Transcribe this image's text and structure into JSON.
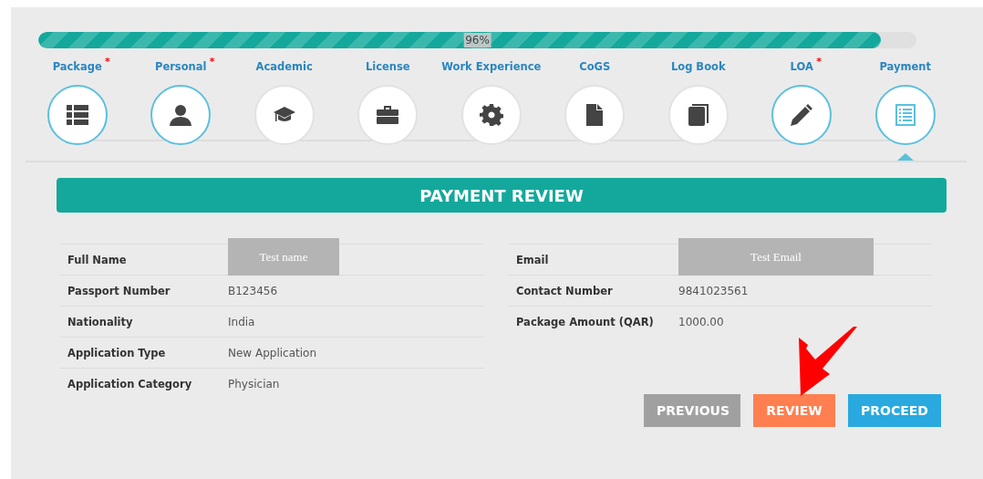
{
  "progress": {
    "level": 0.96,
    "reading": "96%"
  },
  "steps": [
    {
      "label": "Package",
      "marker": "*",
      "done": true,
      "selected": false,
      "kind": "list"
    },
    {
      "label": "Personal",
      "marker": "*",
      "done": true,
      "selected": false,
      "kind": "person"
    },
    {
      "label": "Academic",
      "done": false,
      "selected": false,
      "kind": "cap"
    },
    {
      "label": "License",
      "done": false,
      "selected": false,
      "kind": "briefcase"
    },
    {
      "label": "Work Experience",
      "done": false,
      "selected": false,
      "kind": "gear"
    },
    {
      "label": "CoGS",
      "done": false,
      "selected": false,
      "kind": "file"
    },
    {
      "label": "Log Book",
      "done": false,
      "selected": false,
      "kind": "book"
    },
    {
      "label": "LOA",
      "marker": "*",
      "done": true,
      "selected": false,
      "kind": "pencil"
    },
    {
      "label": "Payment",
      "done": true,
      "selected": true,
      "kind": "form"
    }
  ],
  "section_title": "PAYMENT REVIEW",
  "left_table": [
    {
      "label": "Full Name",
      "value": "Test name",
      "kind": "field"
    },
    {
      "label": "Passport Number",
      "value": "B123456",
      "kind": "text"
    },
    {
      "label": "Nationality",
      "value": "India",
      "kind": "text"
    },
    {
      "label": "Application Type",
      "value": "New Application",
      "kind": "text"
    },
    {
      "label": "Application Category",
      "value": "Physician",
      "kind": "text"
    }
  ],
  "right_table": [
    {
      "label": "Email",
      "value": "Test Email",
      "kind": "field"
    },
    {
      "label": "Contact Number",
      "value": "9841023561",
      "kind": "text"
    },
    {
      "label": "Package Amount (QAR)",
      "value": "1000.00",
      "kind": "text"
    }
  ],
  "buttons": [
    {
      "label": "PREVIOUS",
      "kind": "secondary"
    },
    {
      "label": "REVIEW",
      "kind": "warning"
    },
    {
      "label": "PROCEED",
      "kind": "primary"
    }
  ]
}
